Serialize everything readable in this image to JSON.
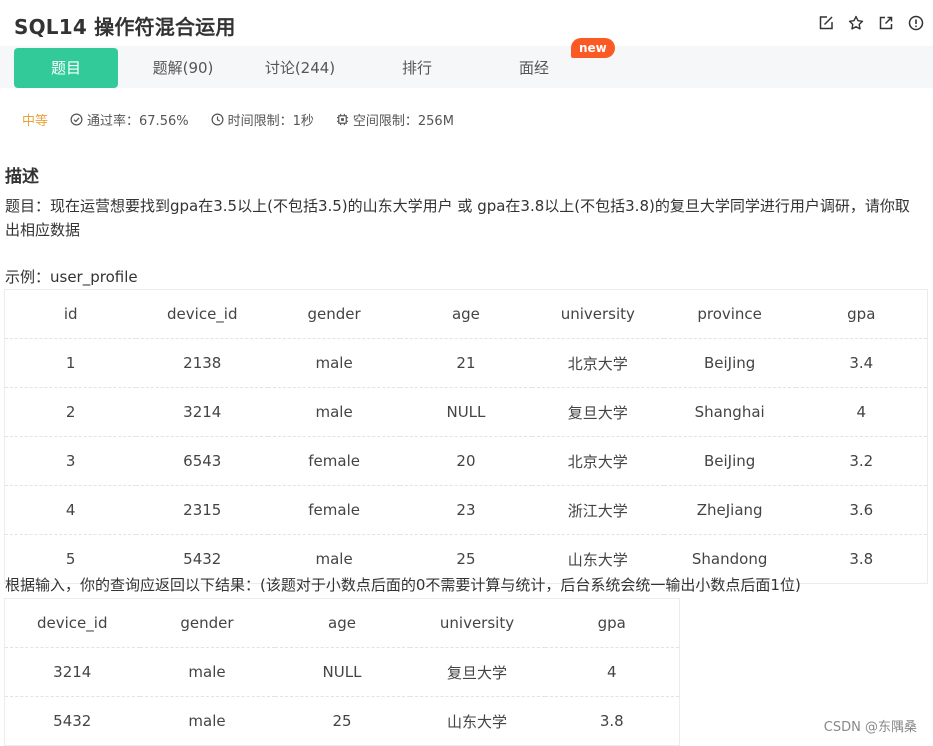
{
  "header": {
    "title": "SQL14  操作符混合运用"
  },
  "tabs": [
    {
      "label": "题目"
    },
    {
      "label": "题解(90)"
    },
    {
      "label": "讨论(244)"
    },
    {
      "label": "排行"
    },
    {
      "label": "面经"
    }
  ],
  "new_badge": "new",
  "meta": {
    "difficulty": "中等",
    "pass_rate": "通过率：67.56%",
    "time_limit": "时间限制：1秒",
    "space_limit": "空间限制：256M"
  },
  "description": {
    "heading": "描述",
    "text": "题目：现在运营想要找到gpa在3.5以上(不包括3.5)的山东大学用户 或 gpa在3.8以上(不包括3.8)的复旦大学同学进行用户调研，请你取出相应数据",
    "example_label": "示例：user_profile",
    "result_label": "根据输入，你的查询应返回以下结果：(该题对于小数点后面的0不需要计算与统计，后台系统会统一输出小数点后面1位)"
  },
  "example_table": {
    "headers": [
      "id",
      "device_id",
      "gender",
      "age",
      "university",
      "province",
      "gpa"
    ],
    "rows": [
      [
        "1",
        "2138",
        "male",
        "21",
        "北京大学",
        "BeiJing",
        "3.4"
      ],
      [
        "2",
        "3214",
        "male",
        "NULL",
        "复旦大学",
        "Shanghai",
        "4"
      ],
      [
        "3",
        "6543",
        "female",
        "20",
        "北京大学",
        "BeiJing",
        "3.2"
      ],
      [
        "4",
        "2315",
        "female",
        "23",
        "浙江大学",
        "ZheJiang",
        "3.6"
      ],
      [
        "5",
        "5432",
        "male",
        "25",
        "山东大学",
        "Shandong",
        "3.8"
      ]
    ]
  },
  "result_table": {
    "headers": [
      "device_id",
      "gender",
      "age",
      "university",
      "gpa"
    ],
    "rows": [
      [
        "3214",
        "male",
        "NULL",
        "复旦大学",
        "4"
      ],
      [
        "5432",
        "male",
        "25",
        "山东大学",
        "3.8"
      ]
    ]
  },
  "watermark": "CSDN @东隅桑",
  "colors": {
    "accent": "#32ca99",
    "badge": "#fb5a24",
    "difficulty": "#e8a33a"
  },
  "icons": [
    "edit-icon",
    "star-icon",
    "share-icon",
    "report-icon",
    "check-circle-icon",
    "clock-icon",
    "chip-icon"
  ]
}
